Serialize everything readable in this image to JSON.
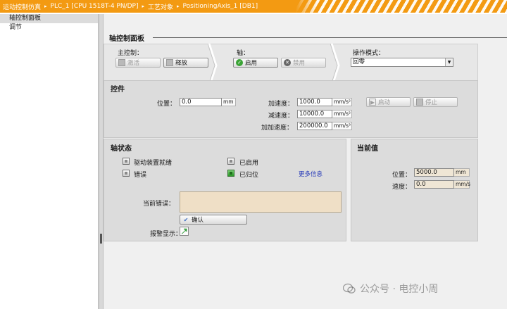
{
  "titlebar": {
    "crumbs": [
      "运动控制仿真",
      "PLC_1 [CPU 1518T-4 PN/DP]",
      "工艺对象",
      "PositioningAxis_1 [DB1]"
    ],
    "separator": "▸"
  },
  "tree": {
    "items": [
      {
        "label": "轴控制面板",
        "selected": true
      },
      {
        "label": "调节",
        "selected": false
      }
    ]
  },
  "panel": {
    "title": "轴控制面板"
  },
  "master": {
    "label": "主控制：",
    "activate_label": "激活",
    "deactivate_label": "释放"
  },
  "axis": {
    "label": "轴：",
    "enable_label": "启用",
    "disable_label": "禁用"
  },
  "mode": {
    "label": "操作模式：",
    "value": "回零"
  },
  "control": {
    "title": "控件",
    "position_label": "位置：",
    "position_value": "0.0",
    "position_unit": "mm",
    "accel_label": "加速度：",
    "accel_value": "1000.0",
    "accel_unit": "mm/s²",
    "decel_label": "减速度：",
    "decel_value": "10000.0",
    "decel_unit": "mm/s²",
    "jerk_label": "加加速度：",
    "jerk_value": "200000.0",
    "jerk_unit": "mm/s³",
    "start_label": "启动",
    "stop_label": "停止"
  },
  "status": {
    "title": "轴状态",
    "drive_ready": "驱动装置就绪",
    "error": "错误",
    "enabled": "已启用",
    "homed": "已归位",
    "homed_active": true,
    "more_info": "更多信息",
    "current_error_label": "当前错误：",
    "confirm_label": "确认",
    "alarm_label": "报警显示："
  },
  "current": {
    "title": "当前值",
    "position_label": "位置：",
    "position_value": "5000.0",
    "position_unit": "mm",
    "speed_label": "速度：",
    "speed_value": "0.0",
    "speed_unit": "mm/s"
  },
  "watermark": {
    "text": "公众号 · 电控小周"
  },
  "colors": {
    "titlebar": "#f39a12",
    "enable_green": "#3aa335",
    "link_blue": "#2438b8",
    "readonly_bg": "#efe6d5"
  }
}
